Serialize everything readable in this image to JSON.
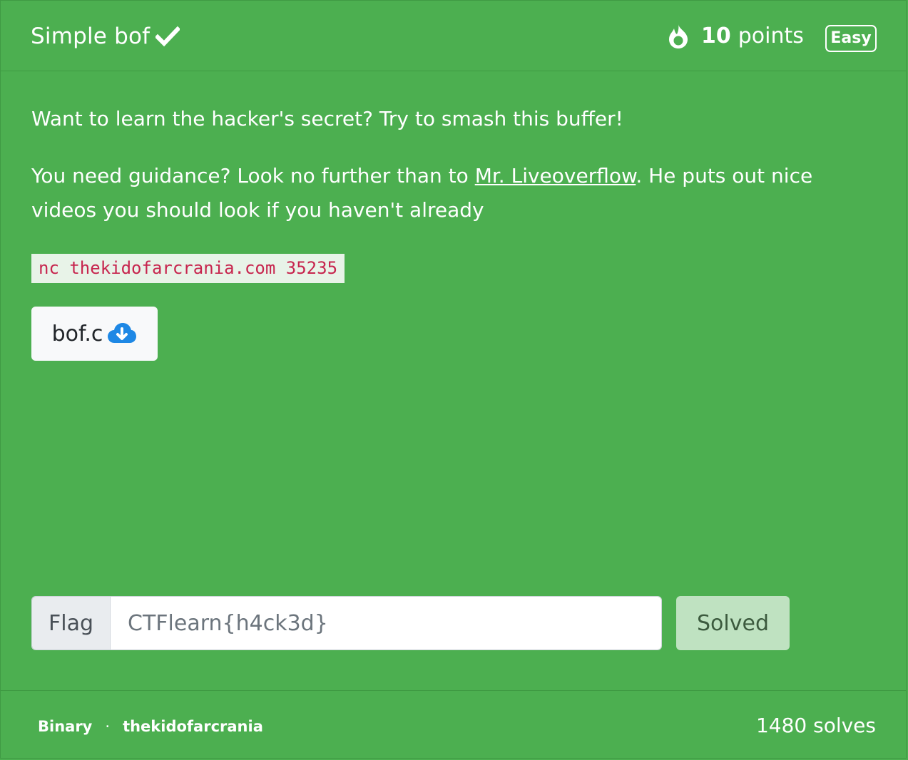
{
  "challenge": {
    "title": "Simple bof",
    "points_value": "10",
    "points_unit": "points",
    "difficulty": "Easy"
  },
  "description": {
    "line1": "Want to learn the hacker's secret? Try to smash this buffer!",
    "line2_before": "You need guidance? Look no further than to ",
    "line2_link": "Mr. Liveoverflow",
    "line2_after": ". He puts out nice videos you should look if you haven't already",
    "command": "nc thekidofarcrania.com 35235"
  },
  "file": {
    "name": "bof.c",
    "icon": "cloud-download-icon"
  },
  "flag": {
    "label": "Flag",
    "value": "CTFlearn{h4ck3d}",
    "submit_label": "Solved"
  },
  "footer": {
    "category": "Binary",
    "separator": "·",
    "author": "thekidofarcrania",
    "solves": "1480 solves"
  },
  "colors": {
    "background": "#4caf50",
    "code_text": "#c7254e",
    "solved_button": "#bfe2c1"
  }
}
